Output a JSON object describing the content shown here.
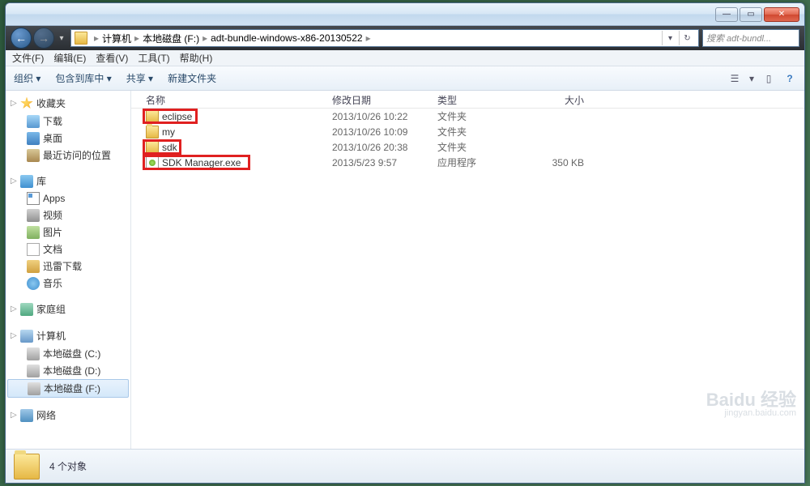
{
  "window_controls": {
    "min": "—",
    "max": "▭",
    "close": "✕"
  },
  "nav": {
    "back": "←",
    "forward": "→",
    "drop": "▾"
  },
  "breadcrumb": {
    "root": "计算机",
    "sep": "▸",
    "drive": "本地磁盘 (F:)",
    "folder": "adt-bundle-windows-x86-20130522"
  },
  "address_actions": {
    "dropdown": "▾",
    "refresh": "↻"
  },
  "search_placeholder": "搜索 adt-bundl...",
  "menubar": [
    "文件(F)",
    "编辑(E)",
    "查看(V)",
    "工具(T)",
    "帮助(H)"
  ],
  "toolbar": {
    "organize": "组织 ▾",
    "include": "包含到库中 ▾",
    "share": "共享 ▾",
    "newfolder": "新建文件夹",
    "view_drop": "▾",
    "help": "?"
  },
  "sidebar": {
    "favorites": {
      "label": "收藏夹",
      "items": [
        {
          "key": "downloads",
          "label": "下载",
          "icon": "ic-dl"
        },
        {
          "key": "desktop",
          "label": "桌面",
          "icon": "ic-desk"
        },
        {
          "key": "recent",
          "label": "最近访问的位置",
          "icon": "ic-rec"
        }
      ]
    },
    "libraries": {
      "label": "库",
      "items": [
        {
          "key": "apps",
          "label": "Apps",
          "icon": "ic-app"
        },
        {
          "key": "videos",
          "label": "视频",
          "icon": "ic-vid"
        },
        {
          "key": "pictures",
          "label": "图片",
          "icon": "ic-pic"
        },
        {
          "key": "documents",
          "label": "文档",
          "icon": "ic-doc"
        },
        {
          "key": "xunlei",
          "label": "迅雷下载",
          "icon": "ic-xl"
        },
        {
          "key": "music",
          "label": "音乐",
          "icon": "ic-mus"
        }
      ]
    },
    "homegroup": {
      "label": "家庭组"
    },
    "computer": {
      "label": "计算机",
      "items": [
        {
          "key": "drive-c",
          "label": "本地磁盘 (C:)",
          "icon": "ic-drv"
        },
        {
          "key": "drive-d",
          "label": "本地磁盘 (D:)",
          "icon": "ic-drv"
        },
        {
          "key": "drive-f",
          "label": "本地磁盘 (F:)",
          "icon": "ic-drv",
          "selected": true
        }
      ]
    },
    "network": {
      "label": "网络"
    }
  },
  "columns": {
    "name": "名称",
    "date": "修改日期",
    "type": "类型",
    "size": "大小"
  },
  "files": [
    {
      "name": "eclipse",
      "date": "2013/10/26 10:22",
      "type": "文件夹",
      "size": "",
      "icon": "ic-folder",
      "highlight": true
    },
    {
      "name": "my",
      "date": "2013/10/26 10:09",
      "type": "文件夹",
      "size": "",
      "icon": "ic-folder",
      "highlight": false
    },
    {
      "name": "sdk",
      "date": "2013/10/26 20:38",
      "type": "文件夹",
      "size": "",
      "icon": "ic-folder",
      "highlight": true
    },
    {
      "name": "SDK Manager.exe",
      "date": "2013/5/23 9:57",
      "type": "应用程序",
      "size": "350 KB",
      "icon": "ic-exe",
      "highlight": true
    }
  ],
  "status": "4 个对象",
  "watermark": {
    "main": "Baidu 经验",
    "sub": "jingyan.baidu.com"
  }
}
